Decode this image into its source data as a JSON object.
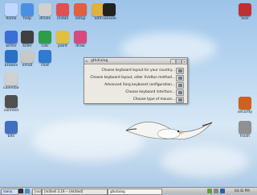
{
  "desktop": {
    "icons_left": [
      {
        "label": "home",
        "color": "#c0d8ff"
      },
      {
        "label": "help",
        "color": "#4a90e2"
      },
      {
        "label": "drives",
        "color": "#d0d0d0"
      },
      {
        "label": "install",
        "color": "#e05050"
      },
      {
        "label": "setup",
        "color": "#e06040"
      },
      {
        "label": "edit",
        "color": "#e0b040"
      },
      {
        "label": "console",
        "color": "#222222"
      },
      {
        "label": "writer",
        "color": "#3a6fd8"
      },
      {
        "label": "killer",
        "color": "#404040"
      },
      {
        "label": "calc",
        "color": "#2e9d4a"
      },
      {
        "label": "paint",
        "color": "#e0c040"
      },
      {
        "label": "draw",
        "color": "#d64a80"
      },
      {
        "label": "browse",
        "color": "#2c6fc8"
      },
      {
        "label": "email",
        "color": "#c8c8c8"
      },
      {
        "label": "chat",
        "color": "#2e7bd0"
      },
      {
        "label": "calendar",
        "color": "#d0d0d0"
      },
      {
        "label": "connect",
        "color": "#505050"
      },
      {
        "label": "blts",
        "color": "#4070c0"
      },
      {
        "label": "connect",
        "color": "#4070c0"
      }
    ],
    "icons_right": [
      {
        "label": "lock",
        "color": "#c03030"
      },
      {
        "label": "security",
        "color": "#d06020"
      },
      {
        "label": "trash",
        "color": "#909090"
      }
    ]
  },
  "dialog": {
    "title": "gtkdialog",
    "rows": [
      "Choose keyboard layout for your country...",
      "Choose keyboard layout, older Xvidtun method...",
      "Advanced Xorg keyboard configuration...",
      "Choose keyboard interface...",
      "Choose type of mouse..."
    ]
  },
  "taskbar": {
    "menu_label": "menu",
    "tasks": [
      "[rxvt]",
      "[mShell 3.19 -- Untitled]",
      "gtkdialog"
    ],
    "clock": "04:42 PM",
    "accent": "#2a5fb0"
  }
}
